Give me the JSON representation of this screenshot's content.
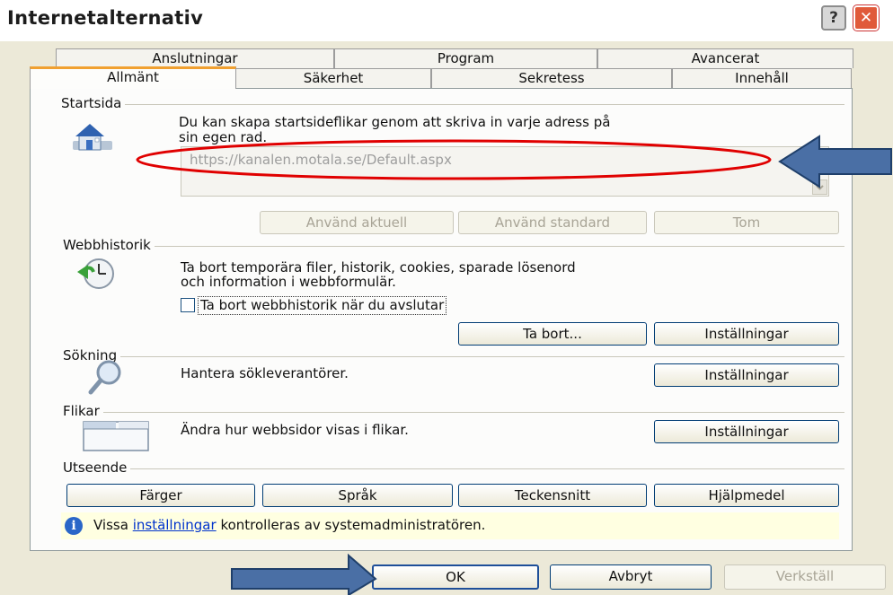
{
  "window": {
    "title": "Internetalternativ",
    "help_label": "?",
    "close_label": "✕"
  },
  "tabs": {
    "row1": [
      "Anslutningar",
      "Program",
      "Avancerat"
    ],
    "row2": [
      "Allmänt",
      "Säkerhet",
      "Sekretess",
      "Innehåll"
    ]
  },
  "startsida": {
    "label": "Startsida",
    "description_line1": "Du kan skapa startsideflikar genom att skriva in varje adress på",
    "description_line2": "sin egen rad.",
    "url": "https://kanalen.motala.se/Default.aspx",
    "btn_current": "Använd aktuell",
    "btn_default": "Använd standard",
    "btn_blank": "Tom"
  },
  "webbhistorik": {
    "label": "Webbhistorik",
    "description_line1": "Ta bort temporära filer, historik, cookies, sparade lösenord",
    "description_line2": "och information i webbformulär.",
    "checkbox_label": "Ta bort webbhistorik när du avslutar",
    "btn_delete": "Ta bort...",
    "btn_settings": "Inställningar"
  },
  "sokning": {
    "label": "Sökning",
    "description": "Hantera sökleverantörer.",
    "btn_settings": "Inställningar"
  },
  "flikar": {
    "label": "Flikar",
    "description": "Ändra hur webbsidor visas i flikar.",
    "btn_settings": "Inställningar"
  },
  "utseende": {
    "label": "Utseende",
    "btn_colors": "Färger",
    "btn_language": "Språk",
    "btn_fonts": "Teckensnitt",
    "btn_accessibility": "Hjälpmedel"
  },
  "info": {
    "prefix": "Vissa",
    "link": "inställningar",
    "suffix": "kontrolleras av systemadministratören."
  },
  "footer": {
    "ok": "OK",
    "cancel": "Avbryt",
    "apply": "Verkställ"
  },
  "colors": {
    "annotation_ellipse": "#e00000",
    "annotation_arrow": "#4a6fa5",
    "info_bar": "#ffffe1"
  }
}
